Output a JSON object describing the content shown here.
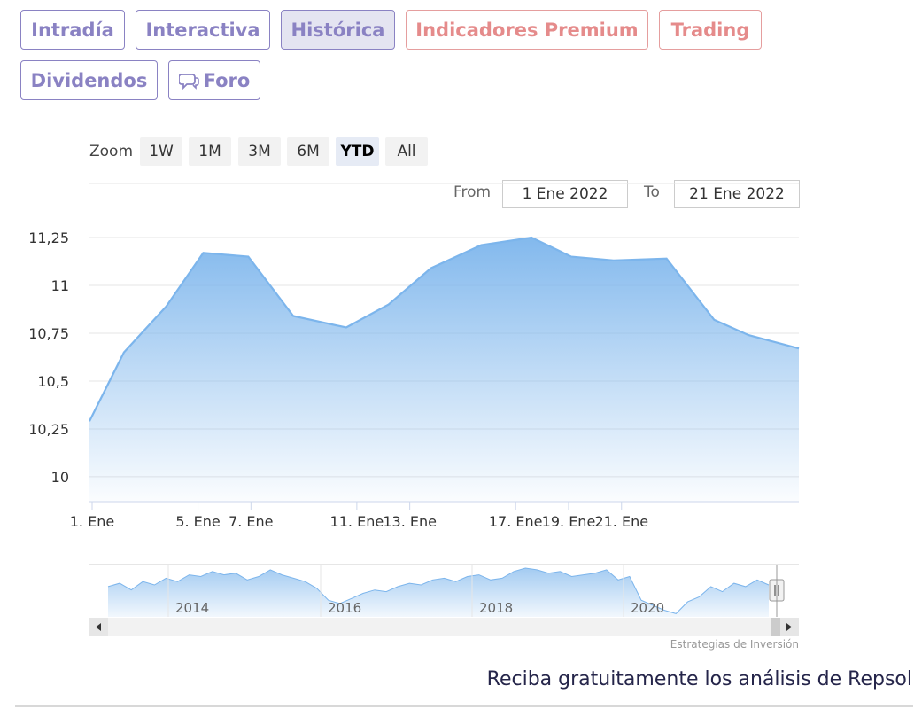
{
  "tabs": [
    {
      "label": "Intradía"
    },
    {
      "label": "Interactiva"
    },
    {
      "label": "Histórica"
    },
    {
      "label": "Indicadores Premium"
    },
    {
      "label": "Trading"
    },
    {
      "label": "Dividendos"
    },
    {
      "label": "Foro",
      "icon": "chat-bubbles-icon"
    }
  ],
  "active_tab": "Histórica",
  "zoom": {
    "label": "Zoom",
    "buttons": [
      "1W",
      "1M",
      "3M",
      "6M",
      "YTD",
      "All"
    ],
    "active": "YTD"
  },
  "range": {
    "from_label": "From",
    "from_value": "1 Ene 2022",
    "to_label": "To",
    "to_value": "21 Ene 2022"
  },
  "chart_data": {
    "type": "area",
    "x_tick_labels": [
      "1. Ene",
      "5. Ene",
      "7. Ene",
      "11. Ene",
      "13. Ene",
      "17. Ene",
      "19. Ene",
      "21. Ene"
    ],
    "x_tick_days": [
      1,
      5,
      7,
      11,
      13,
      17,
      19,
      21
    ],
    "x": [
      0.9,
      2.2,
      3.8,
      5.2,
      6.9,
      8.6,
      10.6,
      12.2,
      13.8,
      15.7,
      17.6,
      19.1,
      20.7,
      22.7,
      24.5,
      25.8,
      27.7
    ],
    "y": [
      10.29,
      10.65,
      10.89,
      11.17,
      11.15,
      10.84,
      10.78,
      10.9,
      11.09,
      11.21,
      11.25,
      11.15,
      11.13,
      11.14,
      10.82,
      10.74,
      10.67
    ],
    "ylim": [
      10,
      11.25
    ],
    "y_ticks": [
      10,
      10.25,
      10.5,
      10.75,
      11,
      11.25
    ],
    "y_tick_labels": [
      "10",
      "10,25",
      "10,5",
      "10,75",
      "11",
      "11,25"
    ],
    "grid": true,
    "line_color": "#7cb5ec",
    "fill_top": "#7cb5ec",
    "fill_bottom": "#ffffff",
    "navigator": {
      "year_labels": [
        "2014",
        "2016",
        "2018",
        "2020"
      ],
      "values": [
        10.6,
        10.8,
        10.4,
        10.9,
        10.7,
        11.1,
        10.9,
        11.3,
        11.2,
        11.5,
        11.3,
        11.4,
        11.0,
        11.2,
        11.6,
        11.3,
        11.1,
        10.9,
        10.5,
        9.8,
        9.6,
        9.9,
        10.2,
        10.4,
        10.3,
        10.6,
        10.8,
        10.7,
        11.0,
        11.1,
        10.9,
        11.2,
        11.3,
        11.0,
        11.1,
        11.5,
        11.7,
        11.6,
        11.4,
        11.5,
        11.2,
        11.3,
        11.4,
        11.6,
        11.0,
        11.2,
        9.8,
        9.5,
        9.2,
        9.0,
        9.7,
        10.0,
        10.6,
        10.3,
        10.8,
        10.6,
        11.0,
        10.7
      ]
    }
  },
  "credits": "Estrategias de Inversión",
  "promo_text": "Reciba gratuitamente los análisis de Repsol"
}
